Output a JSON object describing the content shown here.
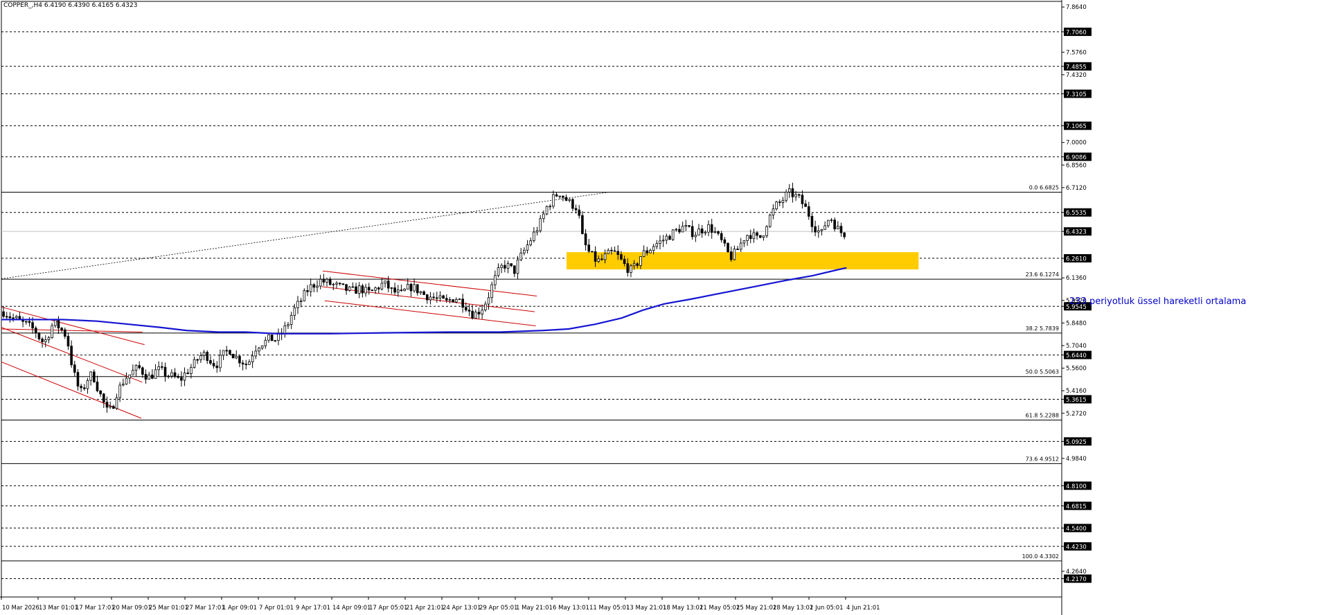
{
  "header": {
    "title": "COPPER_,H4  6.4190 6.4390 6.4165 6.4323"
  },
  "annotation": {
    "ma_label": "233 periyotluk üssel hareketli ortalama"
  },
  "colors": {
    "candles": "#000000",
    "ema": "#1414d2",
    "channel": "#cc0000",
    "zone": "#ffcc00",
    "level": "#000000",
    "price_box": "#000000",
    "ema_label": "#0000cc"
  },
  "chart_data": {
    "type": "candlestick",
    "symbol": "COPPER_",
    "timeframe": "H4",
    "ohlc_last": {
      "open": 6.419,
      "high": 6.439,
      "low": 6.4165,
      "close": 6.4323
    },
    "current_price": 6.4323,
    "y_axis": {
      "min": 4.1,
      "max": 7.9,
      "tick_labels": [
        "7.8640",
        "7.7060",
        "7.5760",
        "7.4855",
        "7.4320",
        "7.3105",
        "7.1065",
        "7.0000",
        "6.9086",
        "6.8560",
        "6.7120",
        "6.5535",
        "6.4323",
        "6.2610",
        "6.1360",
        "5.9920",
        "5.9545",
        "5.8480",
        "5.7040",
        "5.6440",
        "5.5600",
        "5.4160",
        "5.3615",
        "5.2720",
        "5.0925",
        "4.9840",
        "4.8100",
        "4.6815",
        "4.5400",
        "4.4230",
        "4.2640",
        "4.2170"
      ]
    },
    "price_boxes": [
      "7.7060",
      "7.4855",
      "7.3105",
      "7.1065",
      "6.9086",
      "6.5535",
      "6.4323",
      "6.2610",
      "5.9545",
      "5.6440",
      "5.3615",
      "5.0925",
      "4.8100",
      "4.6815",
      "4.5400",
      "4.4230",
      "4.2170"
    ],
    "x_axis": {
      "tick_labels": [
        "10 Mar 2026",
        "13 Mar 01:01",
        "17 Mar 17:01",
        "20 Mar 09:01",
        "25 Mar 01:01",
        "27 Mar 17:01",
        "1 Apr 09:01",
        "7 Apr 01:01",
        "9 Apr 17:01",
        "14 Apr 09:01",
        "17 Apr 05:01",
        "21 Apr 21:01",
        "24 Apr 13:01",
        "29 Apr 05:01",
        "1 May 21:01",
        "6 May 13:01",
        "11 May 05:01",
        "13 May 21:01",
        "18 May 13:01",
        "21 May 05:01",
        "25 May 21:01",
        "28 May 13:01",
        "2 Jun 05:01",
        "4 Jun 21:01"
      ]
    },
    "dashed_levels": [
      7.706,
      7.4855,
      7.3105,
      7.1065,
      6.9086,
      6.5535,
      6.261,
      5.9545,
      5.644,
      5.3615,
      5.0925,
      4.81,
      4.6815,
      4.54,
      4.423,
      4.217
    ],
    "fibonacci": [
      {
        "label": "0.0 6.6825",
        "value": 6.6825
      },
      {
        "label": "23.6 6.1274",
        "value": 6.1274
      },
      {
        "label": "38.2 5.7839",
        "value": 5.7839
      },
      {
        "label": "50.0 5.5063",
        "value": 5.5063
      },
      {
        "label": "61.8 5.2288",
        "value": 5.2288
      },
      {
        "label": "73.6 4.9512",
        "value": 4.9512
      },
      {
        "label": "100.0 4.3302",
        "value": 4.3302
      }
    ],
    "support_zone": {
      "from": 6.19,
      "to": 6.3
    },
    "close_path": [
      5.92,
      5.9,
      5.88,
      5.87,
      5.85,
      5.84,
      5.82,
      5.8,
      5.75,
      5.72,
      5.78,
      5.85,
      5.83,
      5.8,
      5.76,
      5.6,
      5.48,
      5.4,
      5.45,
      5.52,
      5.5,
      5.42,
      5.35,
      5.28,
      5.3,
      5.4,
      5.45,
      5.5,
      5.52,
      5.55,
      5.56,
      5.53,
      5.5,
      5.52,
      5.55,
      5.54,
      5.52,
      5.51,
      5.5,
      5.48,
      5.52,
      5.55,
      5.58,
      5.62,
      5.65,
      5.64,
      5.6,
      5.58,
      5.62,
      5.66,
      5.68,
      5.64,
      5.62,
      5.6,
      5.58,
      5.65,
      5.7,
      5.72,
      5.73,
      5.75,
      5.74,
      5.76,
      5.8,
      5.85,
      5.92,
      5.96,
      6.0,
      6.05,
      6.08,
      6.1,
      6.12,
      6.11,
      6.1,
      6.09,
      6.08,
      6.07,
      6.06,
      6.05,
      6.06,
      6.07,
      6.05,
      6.04,
      6.06,
      6.08,
      6.1,
      6.08,
      6.05,
      6.04,
      6.03,
      6.06,
      6.08,
      6.07,
      6.05,
      6.03,
      6.02,
      6.01,
      6.0,
      5.99,
      5.98,
      6.0,
      6.01,
      5.99,
      5.97,
      5.93,
      5.9,
      5.92,
      5.95,
      6.0,
      6.08,
      6.15,
      6.2,
      6.22,
      6.2,
      6.18,
      6.25,
      6.3,
      6.35,
      6.4,
      6.45,
      6.5,
      6.58,
      6.62,
      6.66,
      6.68,
      6.65,
      6.62,
      6.6,
      6.58,
      6.4,
      6.32,
      6.28,
      6.25,
      6.24,
      6.27,
      6.29,
      6.3,
      6.27,
      6.23,
      6.2,
      6.18,
      6.22,
      6.28,
      6.3,
      6.32,
      6.35,
      6.36,
      6.38,
      6.4,
      6.42,
      6.44,
      6.46,
      6.45,
      6.43,
      6.42,
      6.44,
      6.45,
      6.46,
      6.44,
      6.4,
      6.36,
      6.3,
      6.27,
      6.3,
      6.35,
      6.4,
      6.42,
      6.4,
      6.38,
      6.42,
      6.5,
      6.55,
      6.6,
      6.62,
      6.66,
      6.68,
      6.66,
      6.64,
      6.6,
      6.55,
      6.48,
      6.44,
      6.42,
      6.5,
      6.52,
      6.47,
      6.43,
      6.42
    ],
    "ema_233": [
      [
        0.0,
        5.87
      ],
      [
        0.03,
        5.87
      ],
      [
        0.058,
        5.87
      ],
      [
        0.09,
        5.86
      ],
      [
        0.12,
        5.84
      ],
      [
        0.15,
        5.82
      ],
      [
        0.175,
        5.8
      ],
      [
        0.205,
        5.79
      ],
      [
        0.23,
        5.79
      ],
      [
        0.26,
        5.78
      ],
      [
        0.31,
        5.78
      ],
      [
        0.36,
        5.785
      ],
      [
        0.42,
        5.79
      ],
      [
        0.47,
        5.79
      ],
      [
        0.51,
        5.8
      ],
      [
        0.535,
        5.81
      ],
      [
        0.56,
        5.84
      ],
      [
        0.585,
        5.88
      ],
      [
        0.605,
        5.93
      ],
      [
        0.625,
        5.97
      ],
      [
        0.65,
        6.0
      ],
      [
        0.68,
        6.04
      ],
      [
        0.71,
        6.08
      ],
      [
        0.74,
        6.12
      ],
      [
        0.765,
        6.15
      ],
      [
        0.79,
        6.19
      ],
      [
        0.797,
        6.2
      ]
    ]
  }
}
